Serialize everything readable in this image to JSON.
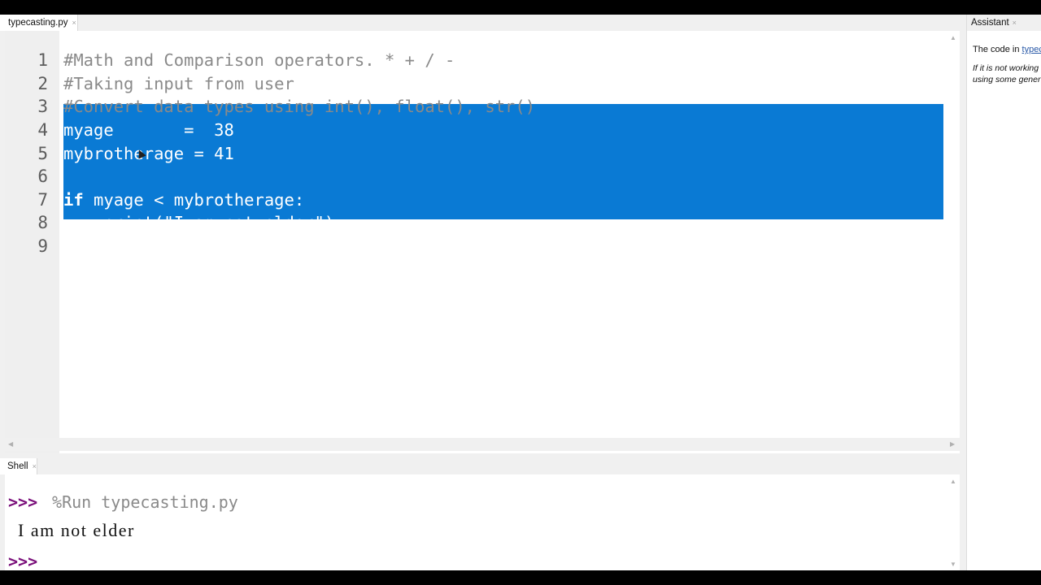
{
  "editor": {
    "tab_label": "typecasting.py",
    "close_glyph": "×",
    "lines": [
      {
        "num": "1",
        "text": "#Math and Comparison operators. * + / -"
      },
      {
        "num": "2",
        "text": "#Taking input from user"
      },
      {
        "num": "3",
        "text": "#Convert data types using int(), float(), str()"
      },
      {
        "num": "4",
        "text": "myage       =  38"
      },
      {
        "num": "5",
        "text": "mybrotherage = 41"
      },
      {
        "num": "6",
        "text": ""
      },
      {
        "num": "7",
        "keyword": "if",
        "rest": " myage < mybrotherage:"
      },
      {
        "num": "8",
        "text": "    print(\"I am not elder\")"
      },
      {
        "num": "9",
        "text": ""
      }
    ],
    "selection_color": "#0a7ad4"
  },
  "shell": {
    "tab_label": "Shell",
    "close_glyph": "×",
    "prompt": ">>>",
    "command": " %Run typecasting.py",
    "output": "I am not elder",
    "prompt_color": "#7a0f7a"
  },
  "assistant": {
    "tab_label": "Assistant",
    "close_glyph": "×",
    "line1_prefix": "The code in ",
    "line1_link": "typec",
    "note_line1": "If it is not working",
    "note_line2": "using some gener"
  }
}
